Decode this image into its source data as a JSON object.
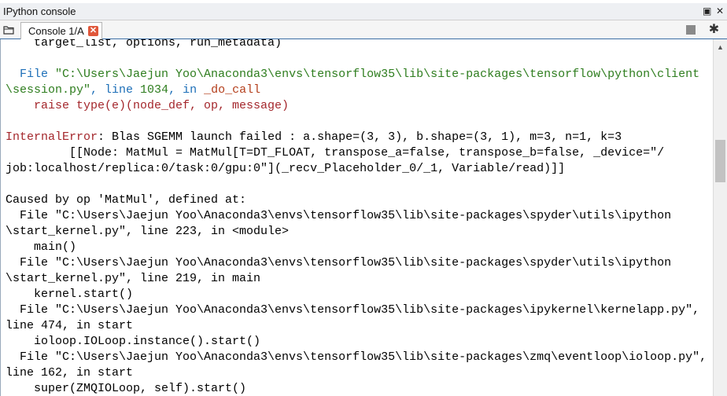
{
  "window": {
    "title": "IPython console"
  },
  "title_controls": {
    "float_glyph": "▣",
    "close_glyph": "✕"
  },
  "tab": {
    "label": "Console 1/A",
    "close_glyph": "✕"
  },
  "toolbar": {
    "gear_glyph": "✱"
  },
  "scroll_glyph": "▲",
  "colors": {
    "error_name": "#a4272c",
    "file_keyword": "#1d6fb8",
    "path": "#2e7d1e",
    "function": "#b43f1c",
    "accent": "#3b6ea5"
  },
  "console": {
    "lines": [
      [
        {
          "t": "    target_list, options, run_metadata)",
          "c": "dark"
        }
      ],
      [
        {
          "t": "",
          "c": "dark"
        }
      ],
      [
        {
          "t": "  File ",
          "c": "blue"
        },
        {
          "t": "\"C:\\Users\\Jaejun Yoo\\Anaconda3\\envs\\tensorflow35\\lib\\site-packages\\tensorflow\\python\\client",
          "c": "green"
        }
      ],
      [
        {
          "t": "\\session.py\"",
          "c": "green"
        },
        {
          "t": ", line ",
          "c": "blue"
        },
        {
          "t": "1034",
          "c": "green"
        },
        {
          "t": ", in ",
          "c": "blue"
        },
        {
          "t": "_do_call",
          "c": "rust"
        }
      ],
      [
        {
          "t": "    raise type(e)(node_def, op, message)",
          "c": "red"
        }
      ],
      [
        {
          "t": "",
          "c": "dark"
        }
      ],
      [
        {
          "t": "InternalError",
          "c": "red"
        },
        {
          "t": ": Blas SGEMM launch failed : a.shape=(3, 3), b.shape=(3, 1), m=3, n=1, k=3",
          "c": "dark"
        }
      ],
      [
        {
          "t": "\t [[Node: MatMul = MatMul[T=DT_FLOAT, transpose_a=false, transpose_b=false, _device=\"/",
          "c": "dark"
        }
      ],
      [
        {
          "t": "job:localhost/replica:0/task:0/gpu:0\"](_recv_Placeholder_0/_1, Variable/read)]]",
          "c": "dark"
        }
      ],
      [
        {
          "t": "",
          "c": "dark"
        }
      ],
      [
        {
          "t": "Caused by op 'MatMul', defined at:",
          "c": "dark"
        }
      ],
      [
        {
          "t": "  File \"C:\\Users\\Jaejun Yoo\\Anaconda3\\envs\\tensorflow35\\lib\\site-packages\\spyder\\utils\\ipython",
          "c": "dark"
        }
      ],
      [
        {
          "t": "\\start_kernel.py\", line 223, in <module>",
          "c": "dark"
        }
      ],
      [
        {
          "t": "    main()",
          "c": "dark"
        }
      ],
      [
        {
          "t": "  File \"C:\\Users\\Jaejun Yoo\\Anaconda3\\envs\\tensorflow35\\lib\\site-packages\\spyder\\utils\\ipython",
          "c": "dark"
        }
      ],
      [
        {
          "t": "\\start_kernel.py\", line 219, in main",
          "c": "dark"
        }
      ],
      [
        {
          "t": "    kernel.start()",
          "c": "dark"
        }
      ],
      [
        {
          "t": "  File \"C:\\Users\\Jaejun Yoo\\Anaconda3\\envs\\tensorflow35\\lib\\site-packages\\ipykernel\\kernelapp.py\",",
          "c": "dark"
        }
      ],
      [
        {
          "t": "line 474, in start",
          "c": "dark"
        }
      ],
      [
        {
          "t": "    ioloop.IOLoop.instance().start()",
          "c": "dark"
        }
      ],
      [
        {
          "t": "  File \"C:\\Users\\Jaejun Yoo\\Anaconda3\\envs\\tensorflow35\\lib\\site-packages\\zmq\\eventloop\\ioloop.py\",",
          "c": "dark"
        }
      ],
      [
        {
          "t": "line 162, in start",
          "c": "dark"
        }
      ],
      [
        {
          "t": "    super(ZMQIOLoop, self).start()",
          "c": "dark"
        }
      ]
    ]
  }
}
